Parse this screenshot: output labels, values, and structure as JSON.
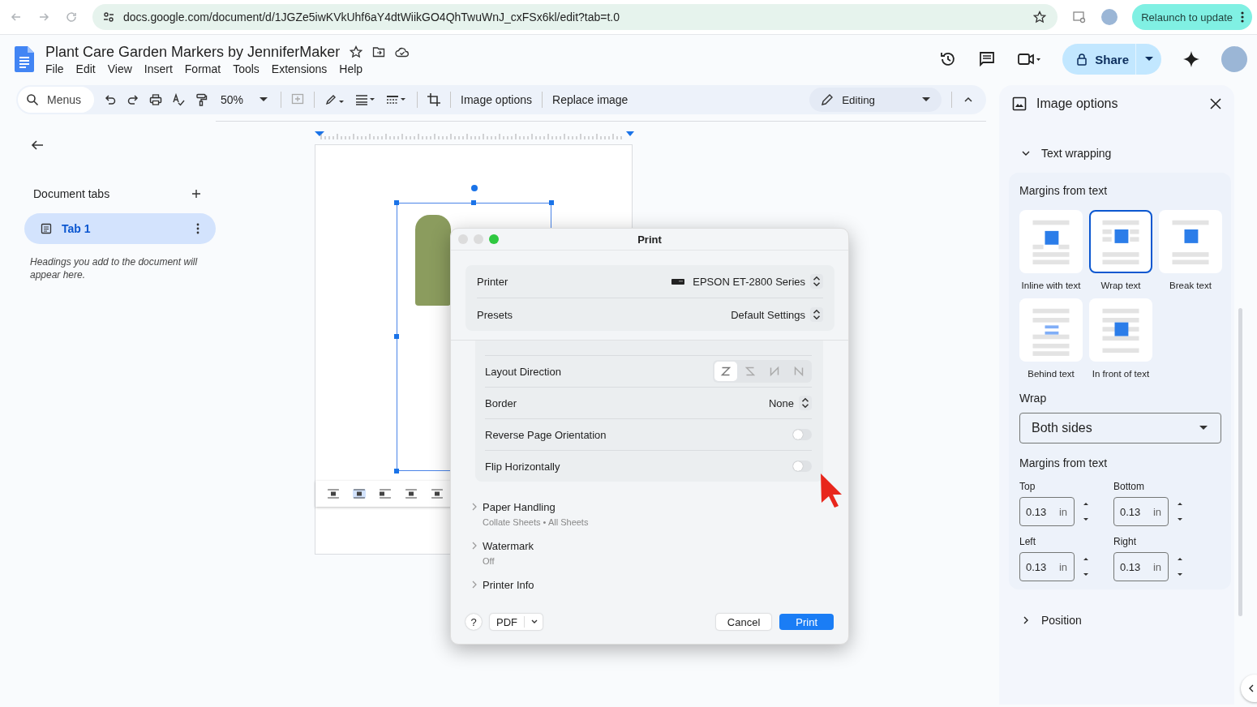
{
  "browser": {
    "url": "docs.google.com/document/d/1JGZe5iwKVkUhf6aY4dtWiikGO4QhTwuWnJ_cxFSx6kl/edit?tab=t.0",
    "relaunch": "Relaunch to update"
  },
  "doc": {
    "title": "Plant Care Garden Markers by JenniferMaker",
    "menus": [
      "File",
      "Edit",
      "View",
      "Insert",
      "Format",
      "Tools",
      "Extensions",
      "Help"
    ],
    "share": "Share"
  },
  "toolbar": {
    "search": "Menus",
    "zoom": "50%",
    "buttons": [
      "Image options",
      "Replace image"
    ],
    "mode": "Editing"
  },
  "sidebar": {
    "heading": "Document tabs",
    "tabs": [
      {
        "label": "Tab 1",
        "selected": true
      }
    ],
    "hint": "Headings you add to the document will appear here."
  },
  "print_dialog": {
    "title": "Print",
    "top_rows": [
      {
        "label": "Printer",
        "value": "EPSON ET-2800 Series"
      },
      {
        "label": "Presets",
        "value": "Default Settings"
      }
    ],
    "options": [
      {
        "kind": "segmented",
        "label": "Layout Direction",
        "segments": [
          {
            "kind": "z",
            "selected": true
          },
          {
            "kind": "s",
            "selected": false
          },
          {
            "kind": "n-rev",
            "selected": false
          },
          {
            "kind": "n",
            "selected": false
          }
        ]
      },
      {
        "kind": "select",
        "label": "Border",
        "value": "None"
      },
      {
        "kind": "toggle",
        "label": "Reverse Page Orientation",
        "on": false
      },
      {
        "kind": "toggle",
        "label": "Flip Horizontally",
        "on": false
      }
    ],
    "sections": [
      {
        "title": "Paper Handling",
        "summary": "Collate Sheets • All Sheets",
        "expanded": false
      },
      {
        "title": "Watermark",
        "summary": "Off",
        "expanded": false
      },
      {
        "title": "Printer Info",
        "expanded": false
      }
    ],
    "help": "?",
    "pdf": "PDF",
    "cancel": "Cancel",
    "confirm": "Print"
  },
  "panel": {
    "title": "Image options",
    "section": "Text wrapping",
    "expanded": true,
    "group_title": "Margins from text",
    "wrap_modes": [
      {
        "kind": "inline",
        "label": "Inline with text",
        "selected": false
      },
      {
        "kind": "wrap",
        "label": "Wrap text",
        "selected": true
      },
      {
        "kind": "break",
        "label": "Break text",
        "selected": false
      },
      {
        "kind": "behind",
        "label": "Behind text",
        "selected": false
      },
      {
        "kind": "front",
        "label": "In front of text",
        "selected": false
      }
    ],
    "wrap_label": "Wrap",
    "wrap_value": "Both sides",
    "margins_title": "Margins from text",
    "margins": [
      {
        "label": "Top",
        "value": "0.13",
        "unit": "in"
      },
      {
        "label": "Bottom",
        "value": "0.13",
        "unit": "in"
      },
      {
        "label": "Left",
        "value": "0.13",
        "unit": "in"
      },
      {
        "label": "Right",
        "value": "0.13",
        "unit": "in"
      }
    ],
    "position": "Position",
    "position_expanded": false
  }
}
